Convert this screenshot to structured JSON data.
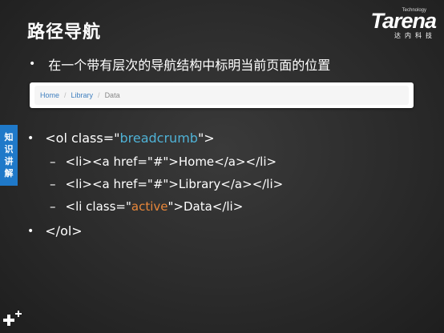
{
  "slide": {
    "title": "路径导航",
    "bullet1": "在一个带有层次的导航结构中标明当前页面的位置"
  },
  "logo": {
    "tech": "Technology",
    "name": "Tarena",
    "cn": "达内科技"
  },
  "breadcrumb": {
    "items": [
      "Home",
      "Library",
      "Data"
    ],
    "separator": "/"
  },
  "side_tab": {
    "chars": [
      "知",
      "识",
      "讲",
      "解"
    ]
  },
  "code": {
    "line1_pre": "<ol class=\"",
    "line1_kw": "breadcrumb",
    "line1_post": "\">",
    "line2": "<li><a href=\"#\">Home</a></li>",
    "line3": "<li><a href=\"#\">Library</a></li>",
    "line4_pre": "<li class=\"",
    "line4_kw": "active",
    "line4_post": "\">Data</li>",
    "line5": "</ol>"
  },
  "colors": {
    "keyword_blue": "#4fb2d6",
    "keyword_orange": "#e8873a",
    "side_tab": "#1f79c9",
    "link": "#3f7fbf"
  },
  "icons": {
    "bullet": "•",
    "dash": "–",
    "corner": "plus-sparkle-icon"
  }
}
